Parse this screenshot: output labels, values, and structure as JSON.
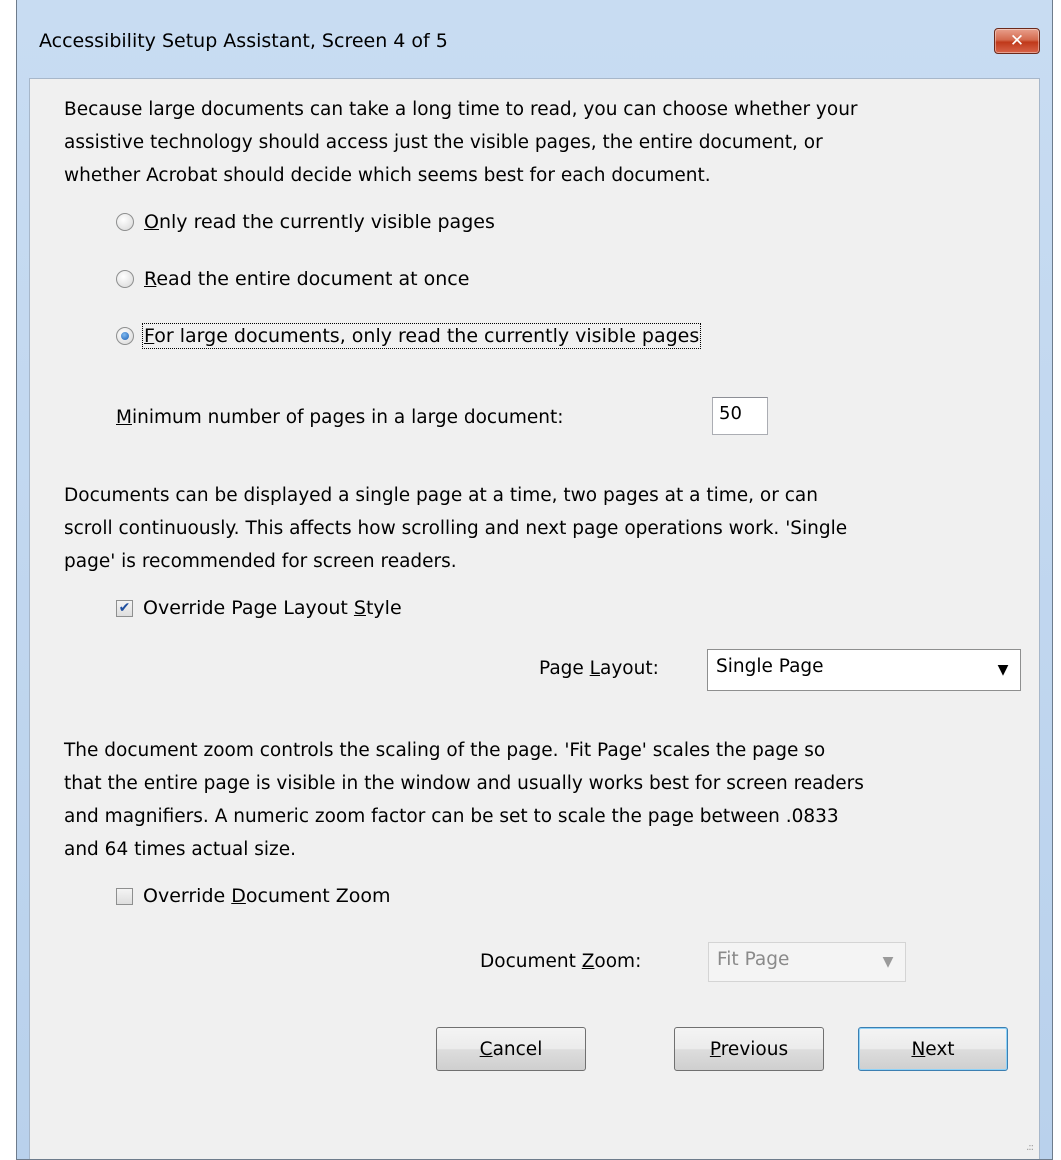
{
  "window": {
    "title": "Accessibility Setup Assistant, Screen 4 of 5",
    "close_glyph": "✕"
  },
  "intro": {
    "line1": "Because large documents can take a long time to read, you can choose whether your",
    "line2": "assistive technology should access just the visible pages, the entire document, or",
    "line3": "whether Acrobat should decide which seems best for each document."
  },
  "read_options": [
    {
      "mnemonic": "O",
      "rest": "nly read the currently visible pages",
      "checked": false
    },
    {
      "mnemonic": "R",
      "rest": "ead the entire document at once",
      "checked": false
    },
    {
      "mnemonic": "F",
      "rest": "or large documents, only read the currently visible pages",
      "checked": true
    }
  ],
  "min_pages": {
    "mnemonic": "M",
    "label_rest": "inimum number of pages in a large document:",
    "value": "50"
  },
  "layout_text": {
    "line1": "Documents can be displayed a single page at a time, two pages at a time, or can",
    "line2": "scroll continuously. This affects how scrolling and next page operations work. 'Single",
    "line3": "page' is recommended for screen readers."
  },
  "override_layout": {
    "label_before": "Override Page Layout ",
    "mnemonic": "S",
    "label_after": "tyle",
    "checked": true,
    "check_glyph": "✔"
  },
  "page_layout": {
    "label_before": "Page ",
    "mnemonic": "L",
    "label_after": "ayout:",
    "value": "Single Page",
    "arrow_glyph": "▼"
  },
  "zoom_text": {
    "line1": "The document zoom controls the scaling of the page. 'Fit Page' scales the page so",
    "line2": "that the entire page is visible in the window and usually works best for screen readers",
    "line3": "and magnifiers. A numeric zoom factor can be set to scale the page between .0833",
    "line4": "and 64 times actual size."
  },
  "override_zoom": {
    "label_before": "Override ",
    "mnemonic": "D",
    "label_after": "ocument Zoom",
    "checked": false
  },
  "document_zoom": {
    "label_before": "Document ",
    "mnemonic": "Z",
    "label_after": "oom:",
    "value": "Fit Page",
    "enabled": false,
    "arrow_glyph": "▼"
  },
  "buttons": {
    "cancel": {
      "mnemonic": "C",
      "rest": "ancel"
    },
    "previous": {
      "mnemonic": "P",
      "rest": "revious"
    },
    "next": {
      "mnemonic": "N",
      "rest": "ext"
    }
  },
  "resize_grip": ".::"
}
